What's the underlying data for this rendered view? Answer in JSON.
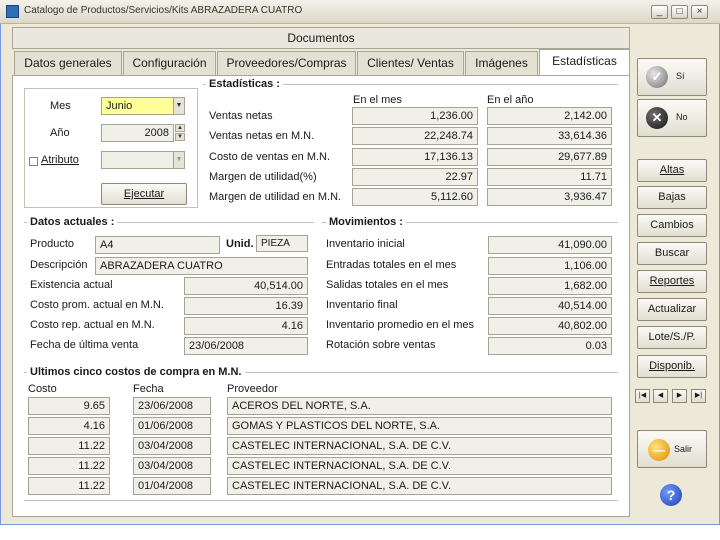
{
  "window": {
    "title": "Catalogo de Productos/Servicios/Kits ABRAZADERA CUATRO",
    "minimize": "_",
    "maximize": "□",
    "close": "×"
  },
  "header": {
    "documentos": "Documentos"
  },
  "tabs": [
    {
      "label": "Datos generales"
    },
    {
      "label": "Configuración"
    },
    {
      "label": "Proveedores/Compras"
    },
    {
      "label": "Clientes/ Ventas"
    },
    {
      "label": "Imágenes"
    },
    {
      "label": "Estadísticas"
    }
  ],
  "filters": {
    "mes_label": "Mes",
    "mes_value": "Junio",
    "anio_label": "Año",
    "anio_value": "2008",
    "atributo_label": "Atributo",
    "atributo_value": "",
    "ejecutar": "Ejecutar"
  },
  "estadisticas": {
    "title": "Estadísticas :",
    "col_mes": "En el mes",
    "col_anio": "En el año",
    "rows": [
      {
        "label": "Ventas netas",
        "mes": "1,236.00",
        "anio": "2,142.00"
      },
      {
        "label": "Ventas netas en M.N.",
        "mes": "22,248.74",
        "anio": "33,614.36"
      },
      {
        "label": "Costo de ventas en M.N.",
        "mes": "17,136.13",
        "anio": "29,677.89"
      },
      {
        "label": "Margen de utilidad(%)",
        "mes": "22.97",
        "anio": "11.71"
      },
      {
        "label": "Margen de utilidad en M.N.",
        "mes": "5,112.60",
        "anio": "3,936.47"
      }
    ]
  },
  "actuales": {
    "title": "Datos actuales :",
    "producto_label": "Producto",
    "producto": "A4",
    "unidad_label": "Unid.",
    "unidad": "PIEZA",
    "descripcion_label": "Descripción",
    "descripcion": "ABRAZADERA CUATRO",
    "rows": [
      {
        "label": "Existencia actual",
        "value": "40,514.00"
      },
      {
        "label": "Costo prom. actual en M.N.",
        "value": "16.39"
      },
      {
        "label": "Costo rep. actual en M.N.",
        "value": "4.16"
      },
      {
        "label": "Fecha de última venta",
        "value": "23/06/2008"
      }
    ]
  },
  "movimientos": {
    "title": "Movimientos :",
    "rows": [
      {
        "label": "Inventario inicial",
        "value": "41,090.00"
      },
      {
        "label": "Entradas totales en el mes",
        "value": "1,106.00"
      },
      {
        "label": "Salidas totales en el mes",
        "value": "1,682.00"
      },
      {
        "label": "Inventario final",
        "value": "40,514.00"
      },
      {
        "label": "Inventario promedio en el mes",
        "value": "40,802.00"
      },
      {
        "label": "Rotación sobre ventas",
        "value": "0.03"
      }
    ]
  },
  "costos": {
    "title": "Ultimos cinco costos de compra en M.N.",
    "col_costo": "Costo",
    "col_fecha": "Fecha",
    "col_proveedor": "Proveedor",
    "rows": [
      {
        "costo": "9.65",
        "fecha": "23/06/2008",
        "proveedor": "ACEROS DEL NORTE, S.A."
      },
      {
        "costo": "4.16",
        "fecha": "01/06/2008",
        "proveedor": "GOMAS Y PLASTICOS DEL NORTE, S.A."
      },
      {
        "costo": "11.22",
        "fecha": "03/04/2008",
        "proveedor": "CASTELEC INTERNACIONAL, S.A. DE C.V."
      },
      {
        "costo": "11.22",
        "fecha": "03/04/2008",
        "proveedor": "CASTELEC INTERNACIONAL, S.A. DE C.V."
      },
      {
        "costo": "11.22",
        "fecha": "01/04/2008",
        "proveedor": "CASTELEC INTERNACIONAL, S.A. DE C.V."
      }
    ]
  },
  "side": {
    "si": "Sí",
    "no": "No",
    "altas": "Altas",
    "bajas": "Bajas",
    "cambios": "Cambios",
    "buscar": "Buscar",
    "reportes": "Reportes",
    "actualizar": "Actualizar",
    "lote": "Lote/S./P.",
    "disponib": "Disponib.",
    "salir": "Salir",
    "nav_first": "|◀",
    "nav_prev": "◀",
    "nav_next": "▶",
    "nav_last": "▶|",
    "help": "?"
  },
  "colors": {
    "highlight": "#ffff99",
    "field": "#f0efe8",
    "panel": "#ffffff",
    "window": "#ece9d8"
  }
}
